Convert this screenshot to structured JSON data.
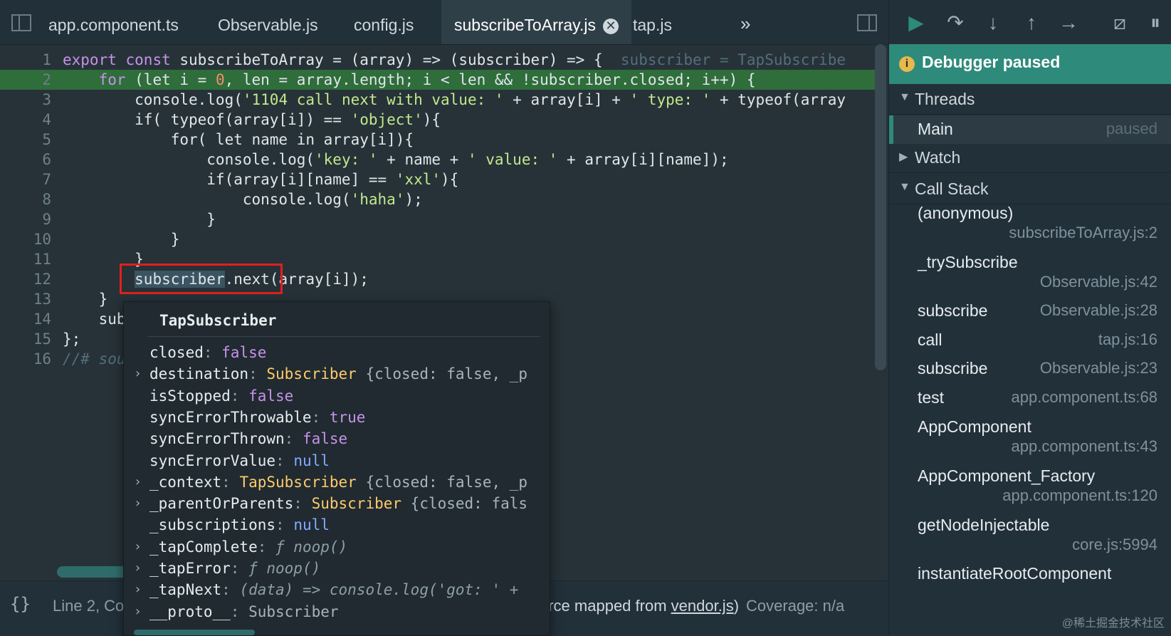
{
  "tabs": [
    {
      "label": "app.component.ts"
    },
    {
      "label": "Observable.js"
    },
    {
      "label": "config.js"
    },
    {
      "label": "subscribeToArray.js",
      "active": true,
      "close": "✕"
    },
    {
      "label": "tap.js"
    }
  ],
  "tabs_overflow": "»",
  "code": {
    "line_numbers": [
      "1",
      "2",
      "3",
      "4",
      "5",
      "6",
      "7",
      "8",
      "9",
      "10",
      "11",
      "12",
      "13",
      "14",
      "15",
      "16"
    ],
    "l1": {
      "a": "export",
      "b": "const",
      "c": " subscribeToArray = (array) => (subscriber) => {",
      "inline": "subscriber = TapSubscribe"
    },
    "l2": {
      "a": "    for",
      "b": " (let i = ",
      "n": "0",
      "c": ", len = array.length; i < len && !subscriber.closed; i++) {"
    },
    "l3": {
      "a": "        console.log(",
      "s": "'1104 call next with value: '",
      "c": " + array[i] + ",
      "s2": "' type: '",
      "d": " + typeof(array"
    },
    "l4": {
      "a": "        if( typeof(array[i]) == ",
      "s": "'object'",
      "c": "){"
    },
    "l5": {
      "a": "            for( let name in array[i]){"
    },
    "l6": {
      "a": "                console.log(",
      "s": "'key: '",
      "c": " + name + ",
      "s2": "' value: '",
      "d": " + array[i][name]);"
    },
    "l7": {
      "a": "                if(array[i][name] == ",
      "s": "'xxl'",
      "c": "){"
    },
    "l8": {
      "a": "                    console.log(",
      "s": "'haha'",
      "c": ");"
    },
    "l9": {
      "a": "                }"
    },
    "l10": {
      "a": "            }"
    },
    "l11": {
      "a": "        }"
    },
    "l12": {
      "pre": "        ",
      "sel": "subscriber",
      "c": ".next",
      "d": "(array[i]);"
    },
    "l13": {
      "a": "    }"
    },
    "l14": {
      "a": "    sub"
    },
    "l15": {
      "a": "};"
    },
    "l16": {
      "a": "//# sou"
    }
  },
  "popover": {
    "title": "TapSubscriber",
    "props": [
      {
        "expand": "",
        "name": "closed",
        "value": "false",
        "kind": "bool"
      },
      {
        "expand": "›",
        "name": "destination",
        "value": "Subscriber",
        "kind": "cls",
        "extra": " {closed: false, _p"
      },
      {
        "expand": "",
        "name": "isStopped",
        "value": "false",
        "kind": "bool"
      },
      {
        "expand": "",
        "name": "syncErrorThrowable",
        "value": "true",
        "kind": "bool"
      },
      {
        "expand": "",
        "name": "syncErrorThrown",
        "value": "false",
        "kind": "bool"
      },
      {
        "expand": "",
        "name": "syncErrorValue",
        "value": "null",
        "kind": "null"
      },
      {
        "expand": "›",
        "name": "_context",
        "value": "TapSubscriber",
        "kind": "cls",
        "extra": " {closed: false, _p"
      },
      {
        "expand": "›",
        "name": "_parentOrParents",
        "value": "Subscriber",
        "kind": "cls",
        "extra": " {closed: fals"
      },
      {
        "expand": "",
        "name": "_subscriptions",
        "value": "null",
        "kind": "null"
      },
      {
        "expand": "›",
        "name": "_tapComplete",
        "value": "ƒ noop()",
        "kind": "fn"
      },
      {
        "expand": "›",
        "name": "_tapError",
        "value": "ƒ noop()",
        "kind": "fn"
      },
      {
        "expand": "›",
        "name": "_tapNext",
        "value": "(data) => console.log('got: ' +",
        "kind": "fn"
      },
      {
        "expand": "›",
        "name": "__proto__",
        "value": "Subscriber",
        "kind": "plain"
      }
    ]
  },
  "status": {
    "braces": "{}",
    "line": "Line 2, Co",
    "source_prefix": "urce mapped from ",
    "source_link": "vendor.js",
    "source_suffix": ")",
    "coverage": "Coverage: n/a"
  },
  "debugger": {
    "banner": "Debugger paused",
    "banner_icon": "i",
    "threads_title": "Threads",
    "thread_name": "Main",
    "thread_state": "paused",
    "watch_title": "Watch",
    "callstack_title": "Call Stack",
    "frames": [
      {
        "name": "(anonymous)",
        "loc": "subscribeToArray.js:2"
      },
      {
        "name": "_trySubscribe",
        "loc": "Observable.js:42"
      },
      {
        "name": "subscribe",
        "loc": "Observable.js:28"
      },
      {
        "name": "call",
        "loc": "tap.js:16"
      },
      {
        "name": "subscribe",
        "loc": "Observable.js:23"
      },
      {
        "name": "test",
        "loc": "app.component.ts:68"
      },
      {
        "name": "AppComponent",
        "loc": "app.component.ts:43"
      },
      {
        "name": "AppComponent_Factory",
        "loc": "app.component.ts:120"
      },
      {
        "name": "getNodeInjectable",
        "loc": "core.js:5994"
      },
      {
        "name": "instantiateRootComponent",
        "loc": ""
      }
    ],
    "toolbar": {
      "resume": "▶",
      "step_over": "↷",
      "step_in": "↓",
      "step_out": "↑",
      "step": "→",
      "deactivate": "⧄",
      "pause": "⏸"
    }
  },
  "watermark": "@稀土掘金技术社区",
  "colors": {
    "accent": "#2e8a7b",
    "highlight_line": "#2f6d3b",
    "annotation": "#e0201e"
  }
}
